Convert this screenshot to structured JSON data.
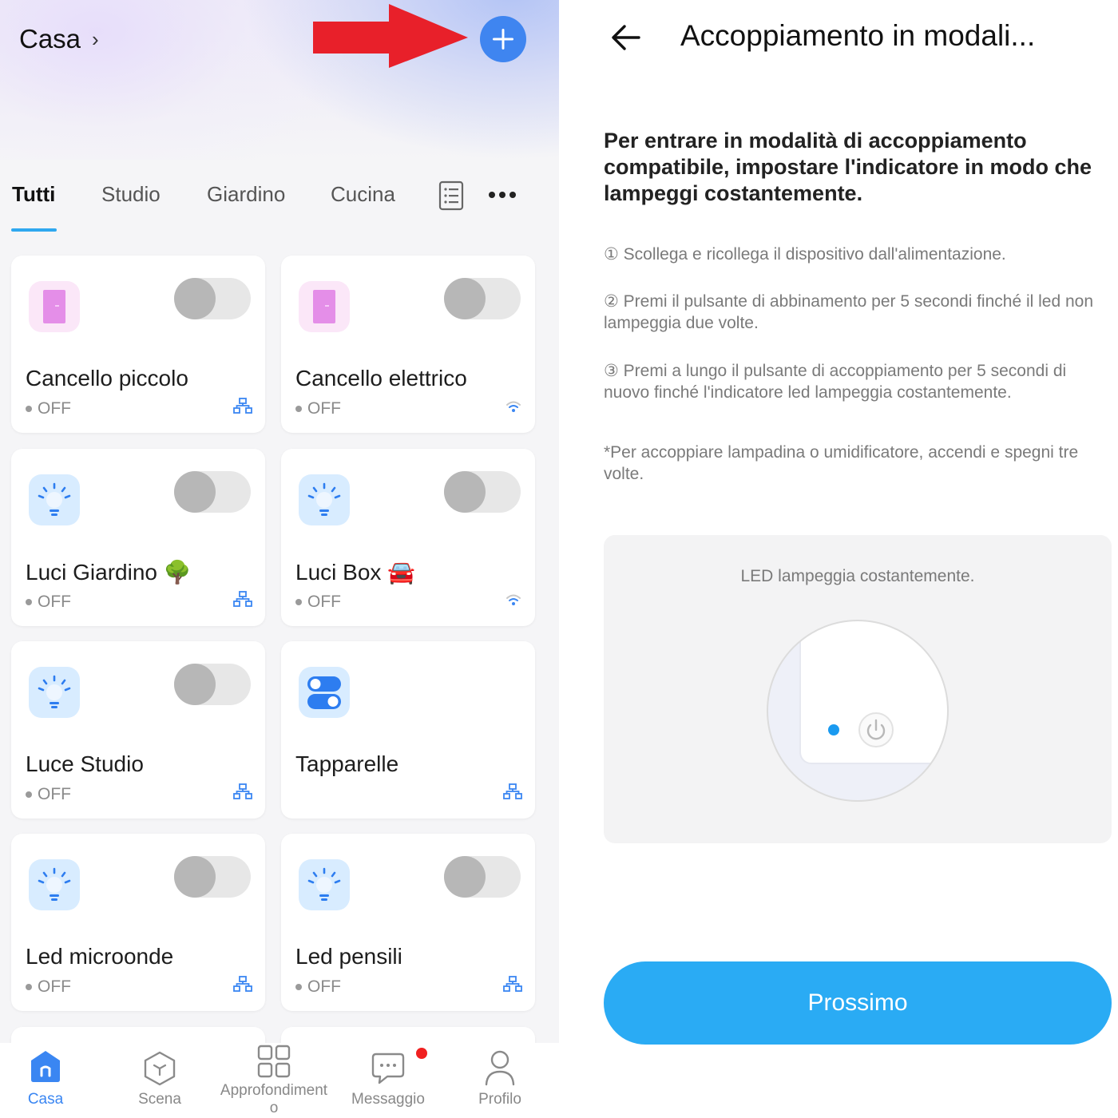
{
  "home": {
    "title": "Casa",
    "chevron": "›"
  },
  "tabs": [
    "Tutti",
    "Studio",
    "Giardino",
    "Cucina"
  ],
  "devices": [
    {
      "name": "Cancello piccolo",
      "status": "OFF",
      "icon": "door-icon",
      "toggle": "off",
      "connection": "zigbee-icon"
    },
    {
      "name": "Cancello elettrico",
      "status": "OFF",
      "icon": "door-icon",
      "toggle": "off",
      "connection": "wifi-icon"
    },
    {
      "name": "Luci Giardino 🌳",
      "status": "OFF",
      "icon": "bulb-icon",
      "toggle": "off",
      "connection": "zigbee-icon"
    },
    {
      "name": "Luci Box 🚘",
      "status": "OFF",
      "icon": "bulb-icon",
      "toggle": "off",
      "connection": "wifi-icon"
    },
    {
      "name": "Luce Studio",
      "status": "OFF",
      "icon": "bulb-icon",
      "toggle": "off",
      "connection": "zigbee-icon"
    },
    {
      "name": "Tapparelle",
      "status": "",
      "icon": "switches-icon",
      "toggle": "none",
      "connection": "zigbee-icon"
    },
    {
      "name": "Led microonde",
      "status": "OFF",
      "icon": "bulb-icon",
      "toggle": "off",
      "connection": "zigbee-icon"
    },
    {
      "name": "Led pensili",
      "status": "OFF",
      "icon": "bulb-icon",
      "toggle": "off",
      "connection": "zigbee-icon"
    }
  ],
  "nav": [
    {
      "label": "Casa",
      "icon": "home-icon",
      "active": true
    },
    {
      "label": "Scena",
      "icon": "scene-icon",
      "active": false
    },
    {
      "label": "Approfondiment\no",
      "icon": "grid-icon",
      "active": false
    },
    {
      "label": "Messaggio",
      "icon": "message-icon",
      "active": false
    },
    {
      "label": "Profilo",
      "icon": "profile-icon",
      "active": false
    }
  ],
  "pairing": {
    "title": "Accoppiamento in modali...",
    "heading": "Per entrare in modalità di accoppiamento compatibile, impostare l'indicatore in modo che lampeggi costantemente.",
    "steps": [
      "① Scollega e ricollega il dispositivo dall'alimentazione.",
      "② Premi il pulsante di abbinamento per 5 secondi finché il led non lampeggia due volte.",
      "③ Premi a lungo il pulsante di accoppiamento per 5 secondi di nuovo finché l'indicatore led lampeggia costantemente."
    ],
    "note": "*Per accoppiare lampadina o umidificatore, accendi e spegni tre volte.",
    "illustration_caption": "LED lampeggia costantemente.",
    "next_button": "Prossimo"
  },
  "colors": {
    "accent_blue": "#2aabf4",
    "add_button": "#3f85f0",
    "annotation_arrow": "#e8202a",
    "notification_dot": "#f02020",
    "led_dot": "#1a9af0"
  }
}
